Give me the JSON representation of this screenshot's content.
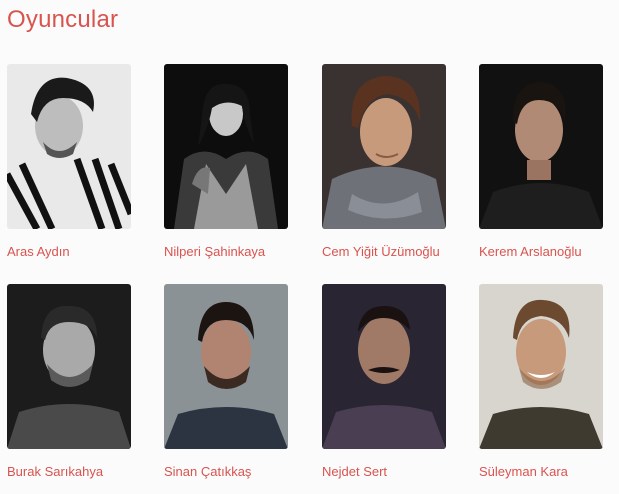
{
  "section": {
    "title": "Oyuncular"
  },
  "cast": [
    {
      "name": "Aras Aydın",
      "photo_icon": "portrait-bw-striped-shirt"
    },
    {
      "name": "Nilperi Şahinkaya",
      "photo_icon": "portrait-bw-leather-jacket"
    },
    {
      "name": "Cem Yiğit Üzümoğlu",
      "photo_icon": "portrait-color-scarf"
    },
    {
      "name": "Kerem Arslanoğlu",
      "photo_icon": "portrait-color-dark"
    },
    {
      "name": "Burak Sarıkahya",
      "photo_icon": "portrait-bw-beard"
    },
    {
      "name": "Sinan Çatıkkaş",
      "photo_icon": "portrait-color-beard"
    },
    {
      "name": "Nejdet Sert",
      "photo_icon": "portrait-color-mustache"
    },
    {
      "name": "Süleyman Kara",
      "photo_icon": "portrait-color-smile"
    }
  ],
  "colors": {
    "accent": "#d9534f",
    "background": "#fbfbfb"
  }
}
